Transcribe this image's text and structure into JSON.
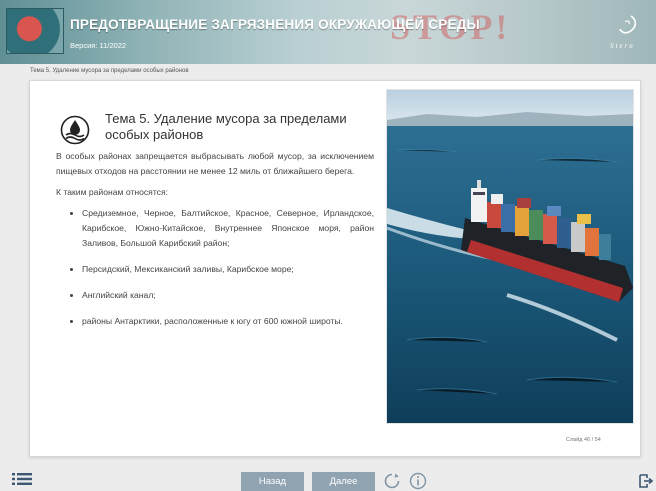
{
  "header": {
    "title": "ПРЕДОТВРАЩЕНИЕ ЗАГРЯЗНЕНИЯ ОКРУЖАЮЩЕЙ СРЕДЫ",
    "version": "Версия: 11/2022",
    "banner_word": "STOP!",
    "brand": "Stern"
  },
  "breadcrumb": "Тема 5. Удаление мусора за пределами особых районов",
  "slide": {
    "title": "Тема 5. Удаление мусора за пределами особых районов",
    "paragraphs": [
      "В особых районах запрещается выбрасывать любой мусор, за исключением пищевых отходов на расстоянии не менее 12 миль от ближайшего берега.",
      "К таким районам относятся:"
    ],
    "items": [
      "Средиземное, Черное, Балтийское, Красное, Северное, Ирландское, Карибское, Южно-Китайское, Внутреннее Японское моря, район Заливов, Большой Карибский район;",
      "Персидский, Мексиканский заливы, Карибское море;",
      "Английский канал;",
      "районы Антарктики, расположенные к югу от 600 южной широты."
    ],
    "slide_counter": "Слайд 46 / 54"
  },
  "nav": {
    "back_label": "Назад",
    "next_label": "Далее"
  },
  "icons": {
    "menu": "list-icon",
    "reload": "reload-icon",
    "info": "info-icon",
    "exit": "exit-icon",
    "topic": "water-drop-icon"
  },
  "colors": {
    "nav_button": "#8fa3b1",
    "header_accent": "#5f8f95"
  }
}
